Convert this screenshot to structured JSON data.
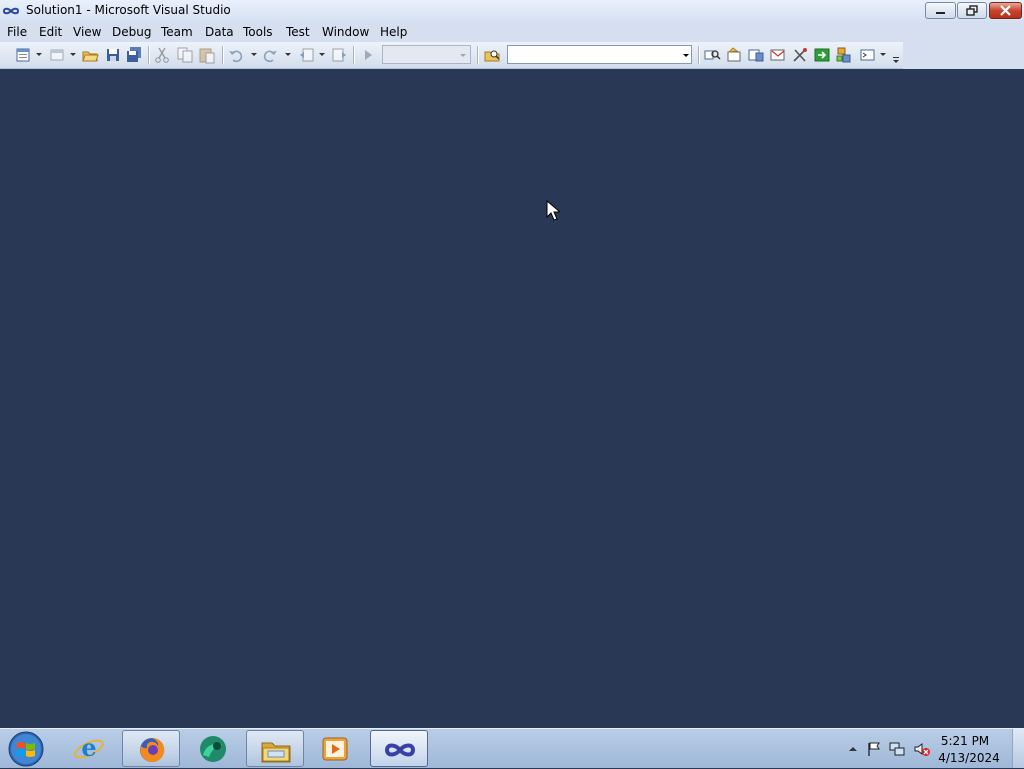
{
  "window": {
    "title": "Solution1 - Microsoft Visual Studio",
    "app_icon": "visual-studio-infinity-icon",
    "controls": [
      "minimize-icon",
      "restore-icon",
      "close-icon"
    ]
  },
  "menu": {
    "items": [
      "File",
      "Edit",
      "View",
      "Debug",
      "Team",
      "Data",
      "Tools",
      "Test",
      "Window",
      "Help"
    ]
  },
  "toolbar": {
    "buttons": [
      "new-project-icon",
      "add-item-icon",
      "open-file-icon",
      "save-icon",
      "save-all-icon",
      "cut-icon",
      "copy-icon",
      "paste-icon",
      "undo-icon",
      "redo-icon",
      "navigate-backward-icon",
      "navigate-forward-icon",
      "start-debugging-icon",
      "find-in-files-icon",
      "solution-explorer-icon",
      "properties-icon",
      "object-browser-icon",
      "toolbox-icon",
      "team-explorer-icon",
      "extension-manager-icon",
      "class-view-icon",
      "command-window-icon",
      "toolbar-options-icon"
    ],
    "configuration_value": "",
    "find_value": ""
  },
  "taskbar": {
    "start_icon": "windows-start-orb-icon",
    "items": [
      {
        "icon": "internet-explorer-icon",
        "state": "pinned"
      },
      {
        "icon": "firefox-icon",
        "state": "open"
      },
      {
        "icon": "browser-icon",
        "state": "pinned"
      },
      {
        "icon": "file-explorer-icon",
        "state": "open"
      },
      {
        "icon": "media-player-icon",
        "state": "pinned"
      },
      {
        "icon": "visual-studio-icon",
        "state": "active"
      }
    ],
    "tray_icons": [
      "show-hidden-icons-arrow-icon",
      "action-center-flag-icon",
      "network-icon",
      "volume-muted-icon"
    ],
    "clock_time": "5:21 PM",
    "clock_date": "4/13/2024"
  },
  "colors": {
    "workspace": "#293955",
    "menubar": "#d5dfef",
    "taskbar": "#a9c0de"
  }
}
